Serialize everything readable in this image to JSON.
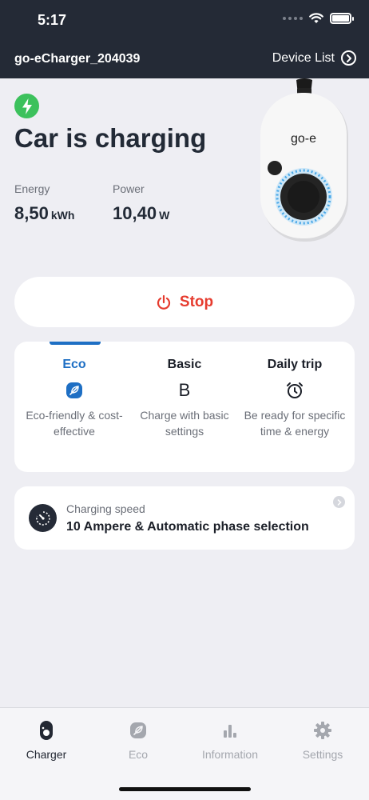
{
  "status_bar": {
    "time": "5:17"
  },
  "header": {
    "device_name": "go-eCharger_204039",
    "device_list_label": "Device List"
  },
  "charging": {
    "headline": "Car is charging",
    "energy": {
      "label": "Energy",
      "value": "8,50",
      "unit": "kWh"
    },
    "power": {
      "label": "Power",
      "value": "10,40",
      "unit": "W"
    },
    "brand_label": "go-e"
  },
  "stop_button": {
    "label": "Stop"
  },
  "modes": [
    {
      "title": "Eco",
      "icon": "leaf-icon",
      "description": "Eco-friendly & cost-effective",
      "active": true
    },
    {
      "title": "Basic",
      "icon": "B",
      "description": "Charge with basic settings",
      "active": false
    },
    {
      "title": "Daily trip",
      "icon": "alarm-clock-icon",
      "description": "Be ready for specific time & energy",
      "active": false
    }
  ],
  "charging_speed": {
    "label": "Charging speed",
    "value": "10 Ampere & Automatic phase selection"
  },
  "tabs": [
    {
      "label": "Charger",
      "icon": "charger-icon",
      "active": true
    },
    {
      "label": "Eco",
      "icon": "leaf-icon",
      "active": false
    },
    {
      "label": "Information",
      "icon": "bar-chart-icon",
      "active": false
    },
    {
      "label": "Settings",
      "icon": "gear-icon",
      "active": false
    }
  ],
  "colors": {
    "accent": "#1e6fc4",
    "stop": "#e63c2f",
    "charging_badge": "#3cc15c",
    "header_bg": "#242a36"
  }
}
